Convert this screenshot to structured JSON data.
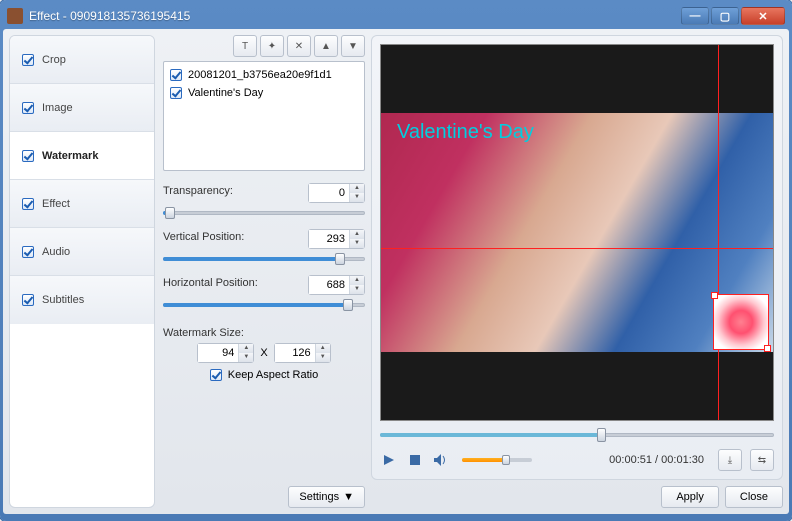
{
  "title": "Effect - 090918135736195415",
  "nav": {
    "items": [
      {
        "label": "Crop",
        "checked": true,
        "selected": false
      },
      {
        "label": "Image",
        "checked": true,
        "selected": false
      },
      {
        "label": "Watermark",
        "checked": true,
        "selected": true
      },
      {
        "label": "Effect",
        "checked": true,
        "selected": false
      },
      {
        "label": "Audio",
        "checked": true,
        "selected": false
      },
      {
        "label": "Subtitles",
        "checked": true,
        "selected": false
      }
    ]
  },
  "watermarks": {
    "items": [
      {
        "label": "20081201_b3756ea20e9f1d1",
        "checked": true
      },
      {
        "label": "Valentine's Day",
        "checked": true
      }
    ]
  },
  "fields": {
    "transparency": {
      "label": "Transparency:",
      "value": "0",
      "slider_pct": 2
    },
    "vertical": {
      "label": "Vertical Position:",
      "value": "293",
      "slider_pct": 86
    },
    "horizontal": {
      "label": "Horizontal Position:",
      "value": "688",
      "slider_pct": 90
    },
    "size": {
      "label": "Watermark Size:",
      "w": "94",
      "sep": "X",
      "h": "126"
    },
    "keep_aspect": {
      "label": "Keep Aspect Ratio",
      "checked": true
    }
  },
  "settings_label": "Settings",
  "preview": {
    "overlay_text": "Valentine's Day"
  },
  "player": {
    "current": "00:00:51",
    "sep": " / ",
    "total": "00:01:30"
  },
  "footer": {
    "apply": "Apply",
    "close": "Close"
  }
}
